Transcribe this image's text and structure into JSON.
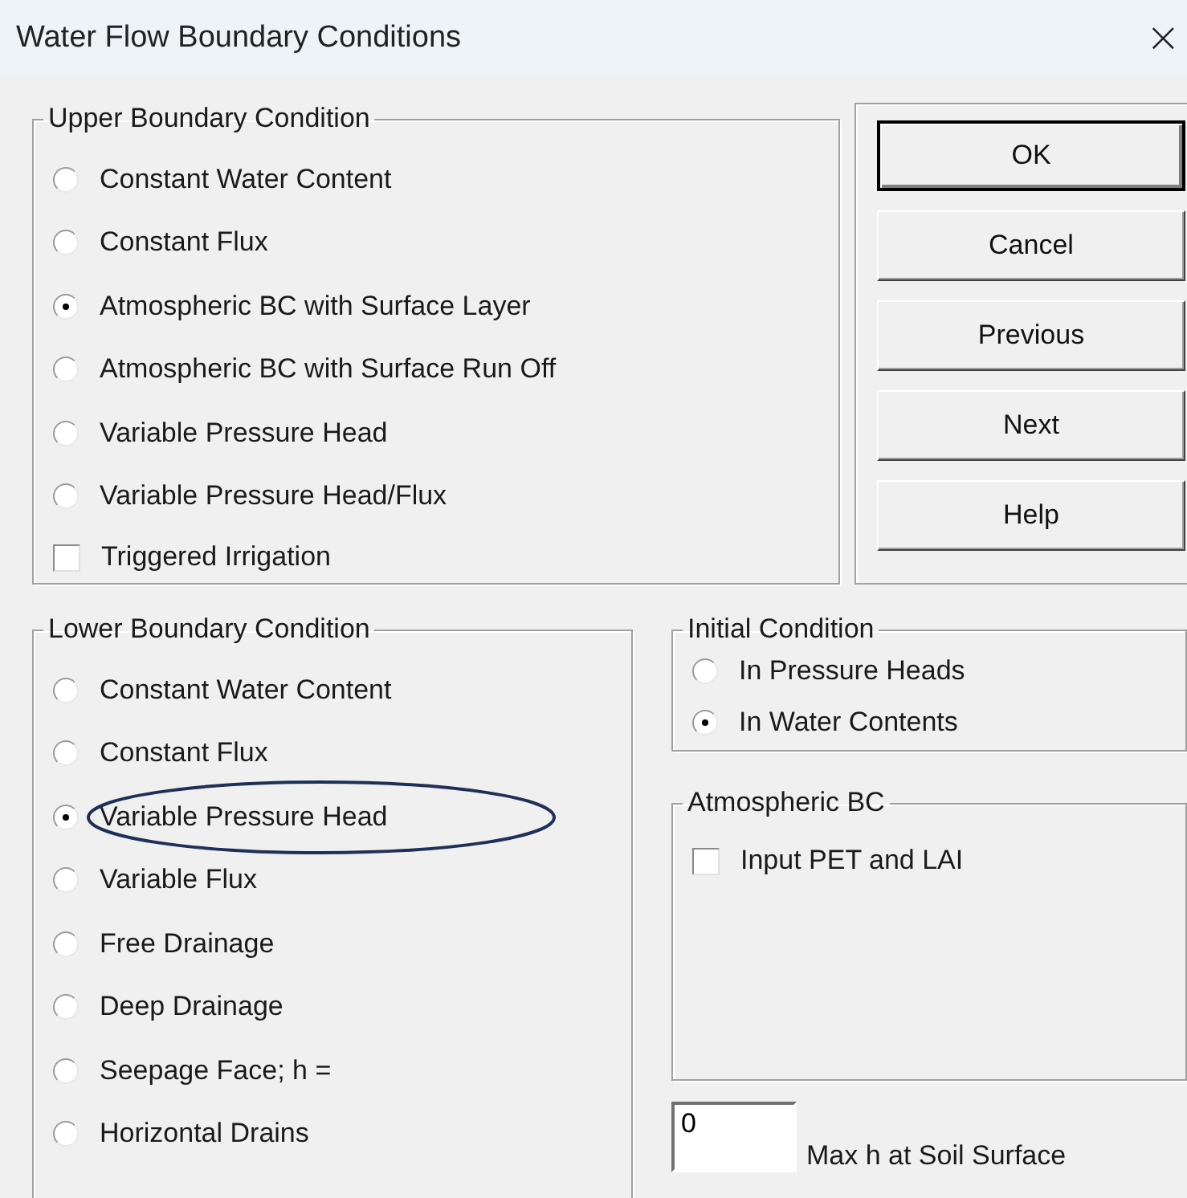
{
  "window": {
    "title": "Water Flow Boundary Conditions",
    "close": "×"
  },
  "upper_boundary": {
    "title": "Upper Boundary Condition",
    "options": [
      {
        "label": "Constant Water Content",
        "selected": false
      },
      {
        "label": "Constant Flux",
        "selected": false
      },
      {
        "label": "Atmospheric BC with Surface Layer",
        "selected": true
      },
      {
        "label": "Atmospheric BC with Surface Run Off",
        "selected": false
      },
      {
        "label": "Variable Pressure Head",
        "selected": false
      },
      {
        "label": "Variable Pressure Head/Flux",
        "selected": false
      }
    ],
    "checkbox": {
      "label": "Triggered Irrigation",
      "checked": false
    }
  },
  "buttons": [
    "OK",
    "Cancel",
    "Previous",
    "Next",
    "Help"
  ],
  "lower_boundary": {
    "title": "Lower Boundary Condition",
    "options": [
      {
        "label": "Constant Water Content",
        "selected": false,
        "highlighted": false
      },
      {
        "label": "Constant Flux",
        "selected": false,
        "highlighted": false
      },
      {
        "label": "Variable Pressure Head",
        "selected": true,
        "highlighted": true
      },
      {
        "label": "Variable Flux",
        "selected": false,
        "highlighted": false
      },
      {
        "label": "Free Drainage",
        "selected": false,
        "highlighted": false
      },
      {
        "label": "Deep Drainage",
        "selected": false,
        "highlighted": false
      },
      {
        "label": "Seepage Face; h =",
        "selected": false,
        "highlighted": false
      },
      {
        "label": "Horizontal Drains",
        "selected": false,
        "highlighted": false
      }
    ]
  },
  "initial_condition": {
    "title": "Initial Condition",
    "options": [
      {
        "label": "In Pressure Heads",
        "selected": false
      },
      {
        "label": "In Water Contents",
        "selected": true
      }
    ]
  },
  "atmospheric_bc": {
    "title": "Atmospheric BC",
    "checkbox": {
      "label": "Input PET and LAI",
      "checked": false
    }
  },
  "max_h": {
    "value": "0",
    "label": "Max h at Soil Surface"
  }
}
